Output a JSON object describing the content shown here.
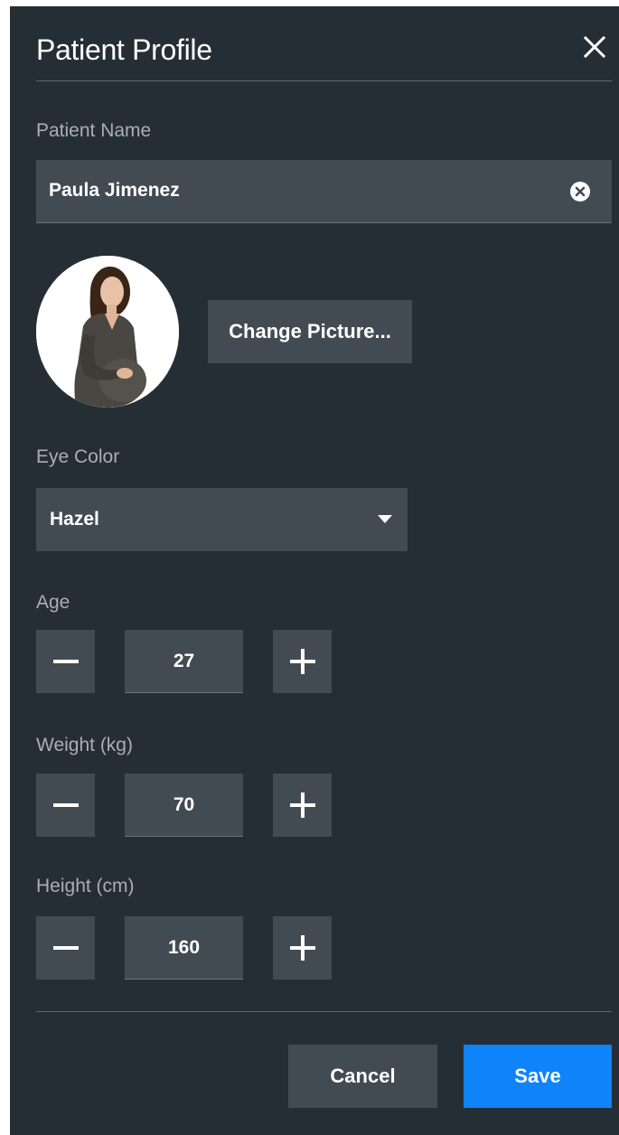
{
  "dialog": {
    "title": "Patient Profile"
  },
  "patient_name": {
    "label": "Patient Name",
    "value": "Paula Jimenez"
  },
  "picture": {
    "change_label": "Change Picture..."
  },
  "eye_color": {
    "label": "Eye Color",
    "selected": "Hazel"
  },
  "age": {
    "label": "Age",
    "value": "27"
  },
  "weight": {
    "label": "Weight (kg)",
    "value": "70"
  },
  "height": {
    "label": "Height (cm)",
    "value": "160"
  },
  "footer": {
    "cancel_label": "Cancel",
    "save_label": "Save"
  },
  "icons": {
    "close": "close-icon",
    "clear": "clear-circle-icon",
    "dropdown": "caret-down-icon",
    "minus": "minus-icon",
    "plus": "plus-icon"
  },
  "colors": {
    "background": "#262e35",
    "field": "#434b52",
    "accent": "#0f84f9",
    "label": "#a9aeb3"
  }
}
